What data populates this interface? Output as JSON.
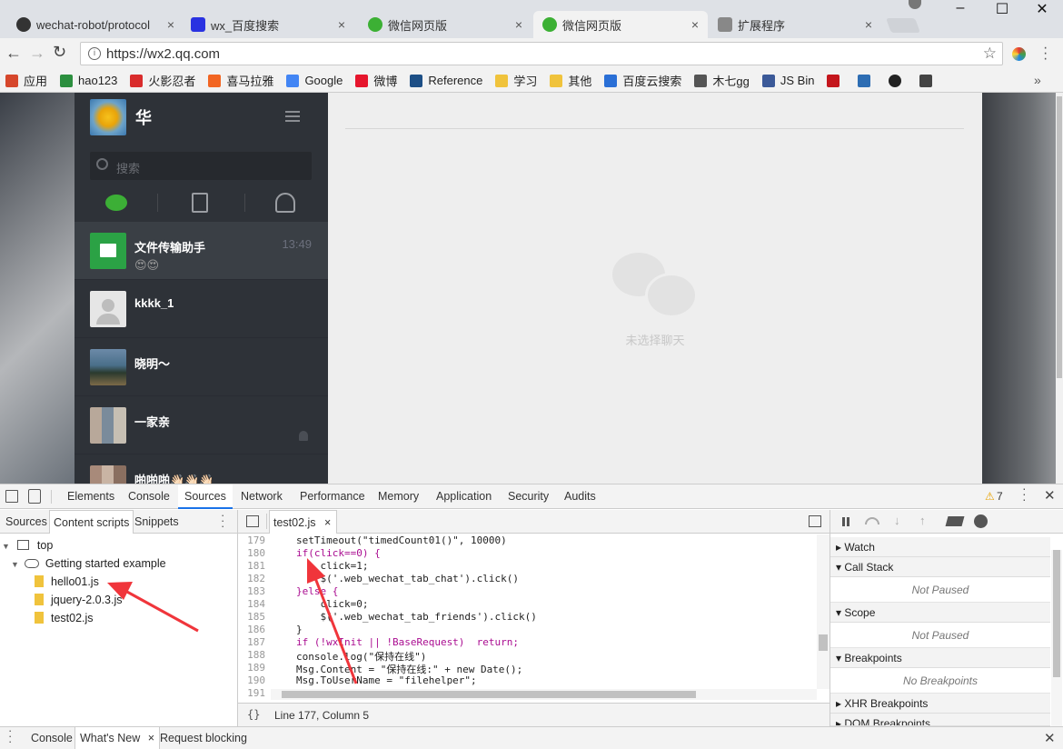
{
  "browser": {
    "tabs": [
      {
        "title": "wechat-robot/protocol",
        "icon": "github-icon",
        "active": false
      },
      {
        "title": "wx_百度搜索",
        "icon": "baidu-icon",
        "active": false
      },
      {
        "title": "微信网页版",
        "icon": "wechat-icon",
        "active": false
      },
      {
        "title": "微信网页版",
        "icon": "wechat-icon",
        "active": true
      },
      {
        "title": "扩展程序",
        "icon": "puzzle-icon",
        "active": false
      }
    ],
    "close_glyph": "×",
    "url": "https://wx2.qq.com",
    "window_controls": [
      "–",
      "☐",
      "✕"
    ],
    "bookmarks": [
      {
        "label": "应用",
        "color": "#d6472c"
      },
      {
        "label": "hao123",
        "color": "#2c8f3f"
      },
      {
        "label": "火影忍者",
        "color": "#d92c2c"
      },
      {
        "label": "喜马拉雅",
        "color": "#f26522"
      },
      {
        "label": "Google",
        "color": "#4285f4"
      },
      {
        "label": "微博",
        "color": "#e6162d"
      },
      {
        "label": "Reference",
        "color": "#1d4f86"
      },
      {
        "label": "学习",
        "color": "#f0c33c"
      },
      {
        "label": "其他",
        "color": "#f0c33c"
      },
      {
        "label": "百度云搜索",
        "color": "#2a6fd6"
      },
      {
        "label": "木七gg",
        "color": "#555555"
      },
      {
        "label": "JS Bin",
        "color": "#3b5998"
      },
      {
        "label": "",
        "color": "#c4161c"
      },
      {
        "label": "",
        "color": "#2d6db3"
      },
      {
        "label": "",
        "color": "#222222"
      },
      {
        "label": "",
        "color": "#444444"
      }
    ],
    "overflow": "»"
  },
  "wechat": {
    "username": "华",
    "search_placeholder": "搜索",
    "chats": [
      {
        "name": "文件传输助手",
        "msg": "😍😍",
        "time": "13:49",
        "avatar_color": "#2ba245",
        "selected": true
      },
      {
        "name": "kkkk_1",
        "msg": "",
        "time": "",
        "avatar_color": "#d9d9d9",
        "selected": false
      },
      {
        "name": "晓明～",
        "msg": "",
        "time": "",
        "avatar_color": "#4a6f8a",
        "selected": false
      },
      {
        "name": "一家亲",
        "msg": "",
        "time": "",
        "avatar_color": "#8a9aa8",
        "selected": false
      },
      {
        "name": "啪啪啪👋🏻👋🏻👋🏻",
        "msg": "",
        "time": "",
        "avatar_color": "#a88a7a",
        "selected": false
      }
    ],
    "empty_label": "未选择聊天"
  },
  "devtools": {
    "tabs": [
      "Elements",
      "Console",
      "Sources",
      "Network",
      "Performance",
      "Memory",
      "Application",
      "Security",
      "Audits"
    ],
    "active_tab": "Sources",
    "warnings": "7",
    "nav_tabs": [
      "Sources",
      "Content scripts",
      "Snippets"
    ],
    "active_nav_tab": "Content scripts",
    "tree": {
      "top": "top",
      "ext": "Getting started example",
      "files": [
        "hello01.js",
        "jquery-2.0.3.js",
        "test02.js"
      ]
    },
    "open_file": "test02.js",
    "code_lines": [
      {
        "n": "179",
        "text": "setTimeout(\"timedCount01()\", 10000)"
      },
      {
        "n": "180",
        "text": "if(click==0) {"
      },
      {
        "n": "181",
        "text": "    click=1;"
      },
      {
        "n": "182",
        "text": "    $('.web_wechat_tab_chat').click()"
      },
      {
        "n": "183",
        "text": "}else {"
      },
      {
        "n": "184",
        "text": "    click=0;"
      },
      {
        "n": "185",
        "text": "    $('.web_wechat_tab_friends').click()"
      },
      {
        "n": "186",
        "text": "}"
      },
      {
        "n": "187",
        "text": "if (!wxInit || !BaseRequest)  return;"
      },
      {
        "n": "188",
        "text": "console.log(\"保持在线\")"
      },
      {
        "n": "189",
        "text": "Msg.Content = \"保持在线:\" + new Date();"
      },
      {
        "n": "190",
        "text": "Msg.ToUserName = \"filehelper\";"
      },
      {
        "n": "191",
        "text": ""
      }
    ],
    "status": "Line 177, Column 5",
    "format_glyph": "{}",
    "sections": [
      {
        "title": "Watch",
        "open": false,
        "body": ""
      },
      {
        "title": "Call Stack",
        "open": true,
        "body": "Not Paused"
      },
      {
        "title": "Scope",
        "open": true,
        "body": "Not Paused"
      },
      {
        "title": "Breakpoints",
        "open": true,
        "body": "No Breakpoints"
      },
      {
        "title": "XHR Breakpoints",
        "open": false,
        "body": ""
      },
      {
        "title": "DOM Breakpoints",
        "open": false,
        "body": ""
      }
    ],
    "drawer_tabs": [
      "Console",
      "What's New",
      "Request blocking"
    ]
  }
}
